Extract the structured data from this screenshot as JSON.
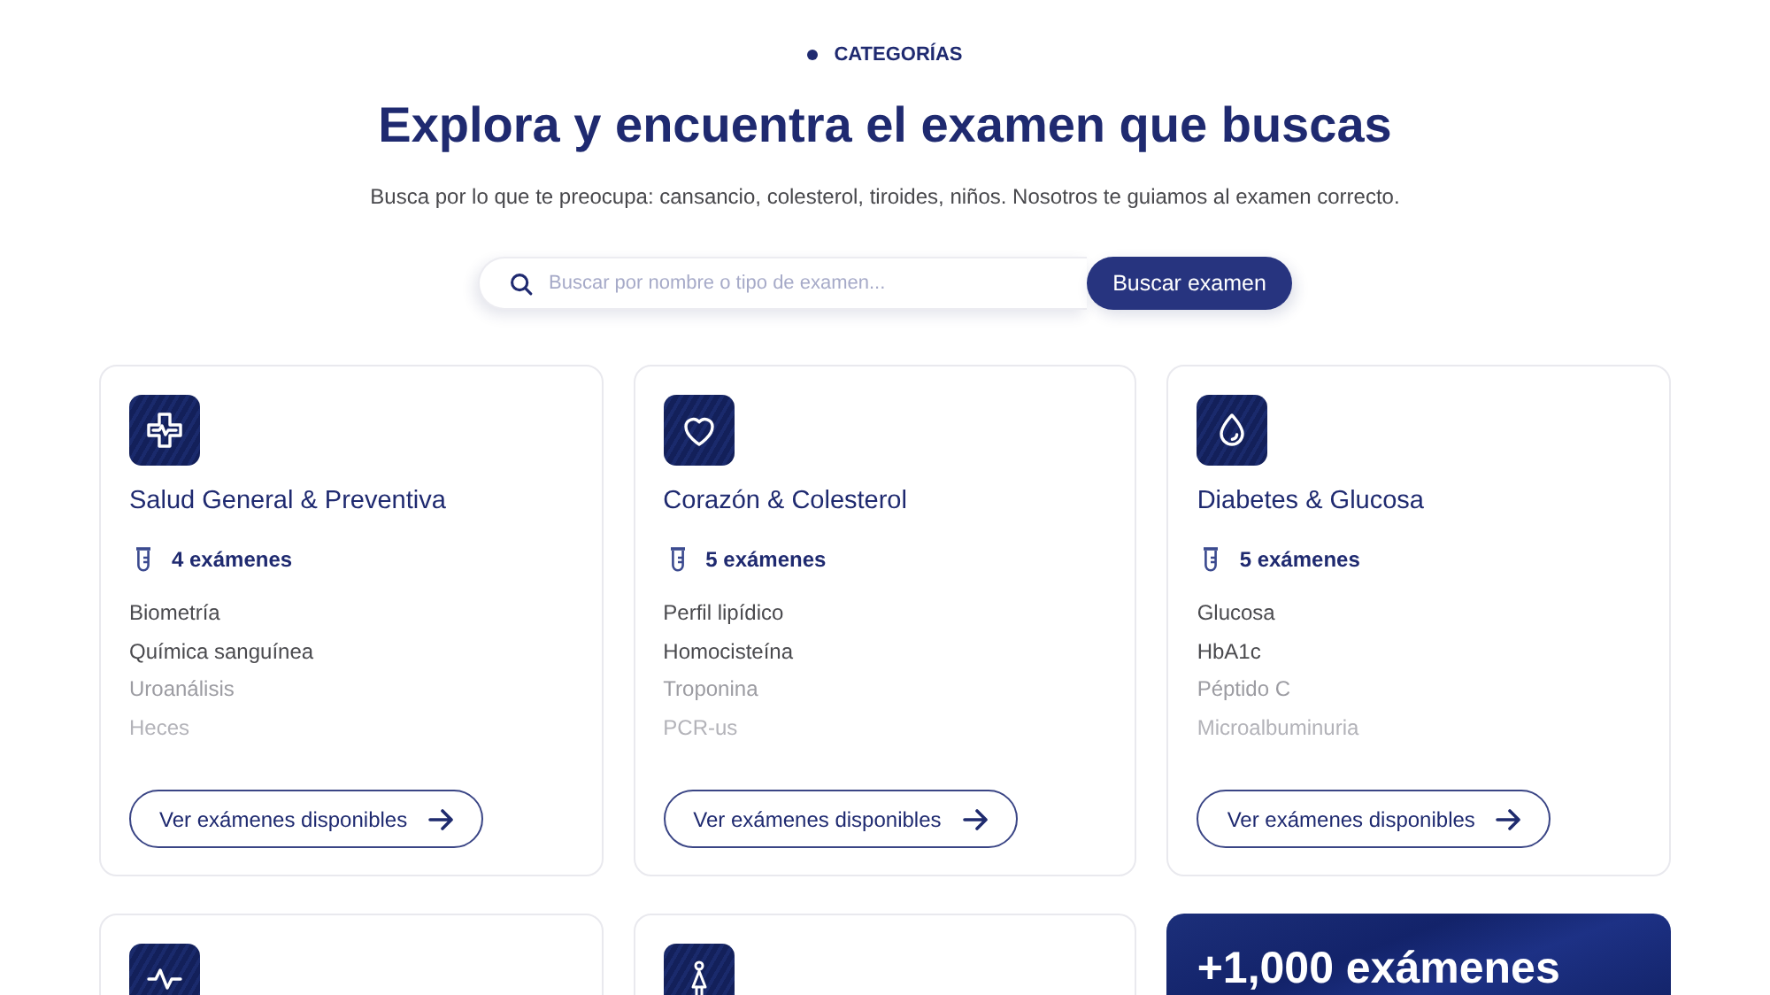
{
  "section": {
    "eyebrow": "CATEGORÍAS",
    "title": "Explora y encuentra el examen que buscas",
    "subtitle": "Busca por lo que te preocupa: cansancio, colesterol, tiroides, niños. Nosotros te guiamos al examen correcto."
  },
  "search": {
    "placeholder": "Buscar por nombre o tipo de examen...",
    "button": "Buscar examen"
  },
  "cards": [
    {
      "kind": "category",
      "title": "Salud General & Preventiva",
      "count": "4 exámenes",
      "exams": [
        {
          "name": "Biometría",
          "color": "#4a4a4e"
        },
        {
          "name": "Química sanguínea",
          "color": "#4a4a4e"
        },
        {
          "name": "Uroanálisis",
          "color": "#9c9ca2"
        },
        {
          "name": "Heces",
          "color": "#b3b3b9"
        }
      ],
      "action": "Ver exámenes disponibles"
    },
    {
      "kind": "category",
      "title": "Corazón & Colesterol",
      "count": "5 exámenes",
      "exams": [
        {
          "name": "Perfil lipídico",
          "color": "#4a4a4e"
        },
        {
          "name": "Homocisteína",
          "color": "#4a4a4e"
        },
        {
          "name": "Troponina",
          "color": "#9c9ca2"
        },
        {
          "name": "PCR-us",
          "color": "#b3b3b9"
        }
      ],
      "action": "Ver exámenes disponibles"
    },
    {
      "kind": "category",
      "title": "Diabetes & Glucosa",
      "count": "5 exámenes",
      "exams": [
        {
          "name": "Glucosa",
          "color": "#4a4a4e"
        },
        {
          "name": "HbA1c",
          "color": "#4a4a4e"
        },
        {
          "name": "Péptido C",
          "color": "#9c9ca2"
        },
        {
          "name": "Microalbuminuria",
          "color": "#b3b3b9"
        }
      ],
      "action": "Ver exámenes disponibles"
    },
    {
      "kind": "category"
    },
    {
      "kind": "category"
    },
    {
      "kind": "promo",
      "title": "+1,000 exámenes"
    }
  ]
}
